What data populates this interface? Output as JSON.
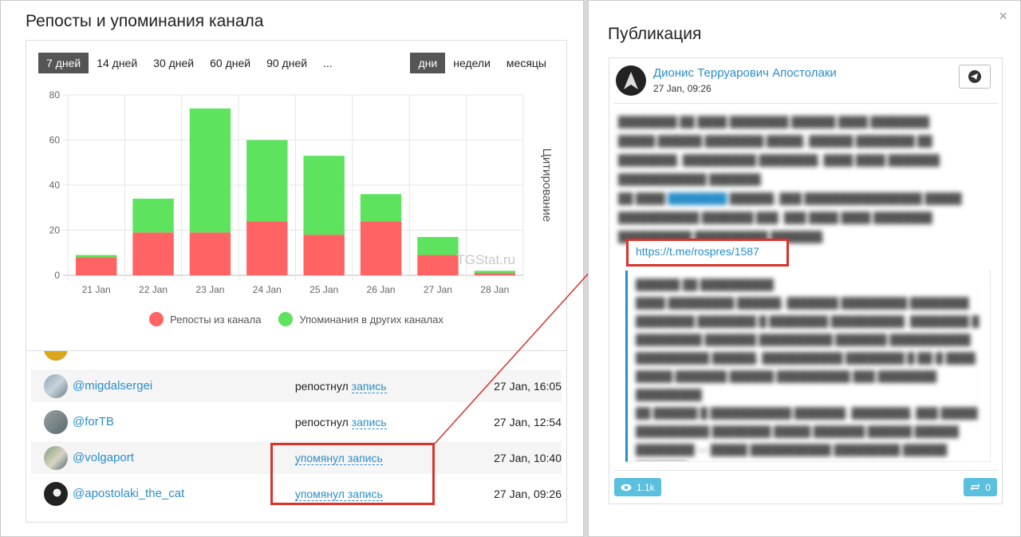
{
  "left": {
    "title": "Репосты и упоминания канала",
    "range_tabs": [
      "7 дней",
      "14 дней",
      "30 дней",
      "60 дней",
      "90 дней",
      "..."
    ],
    "unit_tabs": [
      "дни",
      "недели",
      "месяцы"
    ],
    "watermark": "TGStat.ru",
    "y_axis_title": "Цитирование"
  },
  "chart_data": {
    "type": "bar",
    "stacked": true,
    "categories": [
      "21 Jan",
      "22 Jan",
      "23 Jan",
      "24 Jan",
      "25 Jan",
      "26 Jan",
      "27 Jan",
      "28 Jan"
    ],
    "series": [
      {
        "name": "Репосты из канала",
        "color": "#ff6363",
        "values": [
          8,
          19,
          19,
          24,
          18,
          24,
          9,
          1
        ]
      },
      {
        "name": "Упоминания в других каналах",
        "color": "#5de35d",
        "values": [
          1,
          15,
          55,
          36,
          35,
          12,
          8,
          1
        ]
      }
    ],
    "ylim": [
      0,
      80
    ],
    "yticks": [
      0,
      20,
      40,
      60,
      80
    ],
    "ylabel": "Цитирование",
    "grid": true,
    "legend": "bottom"
  },
  "list": {
    "rows": [
      {
        "user": "@migdalsergei",
        "action_text": "репостнул",
        "action_link": "запись",
        "time": "27 Jan, 16:05"
      },
      {
        "user": "@forTB",
        "action_text": "репостнул",
        "action_link": "запись",
        "time": "27 Jan, 12:54"
      },
      {
        "user": "@volgaport",
        "action_text": "",
        "action_link": "упомянул запись",
        "time": "27 Jan, 10:40"
      },
      {
        "user": "@apostolaki_the_cat",
        "action_text": "",
        "action_link": "упомянул запись",
        "time": "27 Jan, 09:26"
      }
    ]
  },
  "right": {
    "close": "×",
    "title": "Публикация",
    "author": "Дионис Терруарович Апостолаки",
    "date": "27 Jan, 09:26",
    "link": "https://t.me/rospres/1587",
    "views": "1.1k",
    "reposts": "0"
  }
}
